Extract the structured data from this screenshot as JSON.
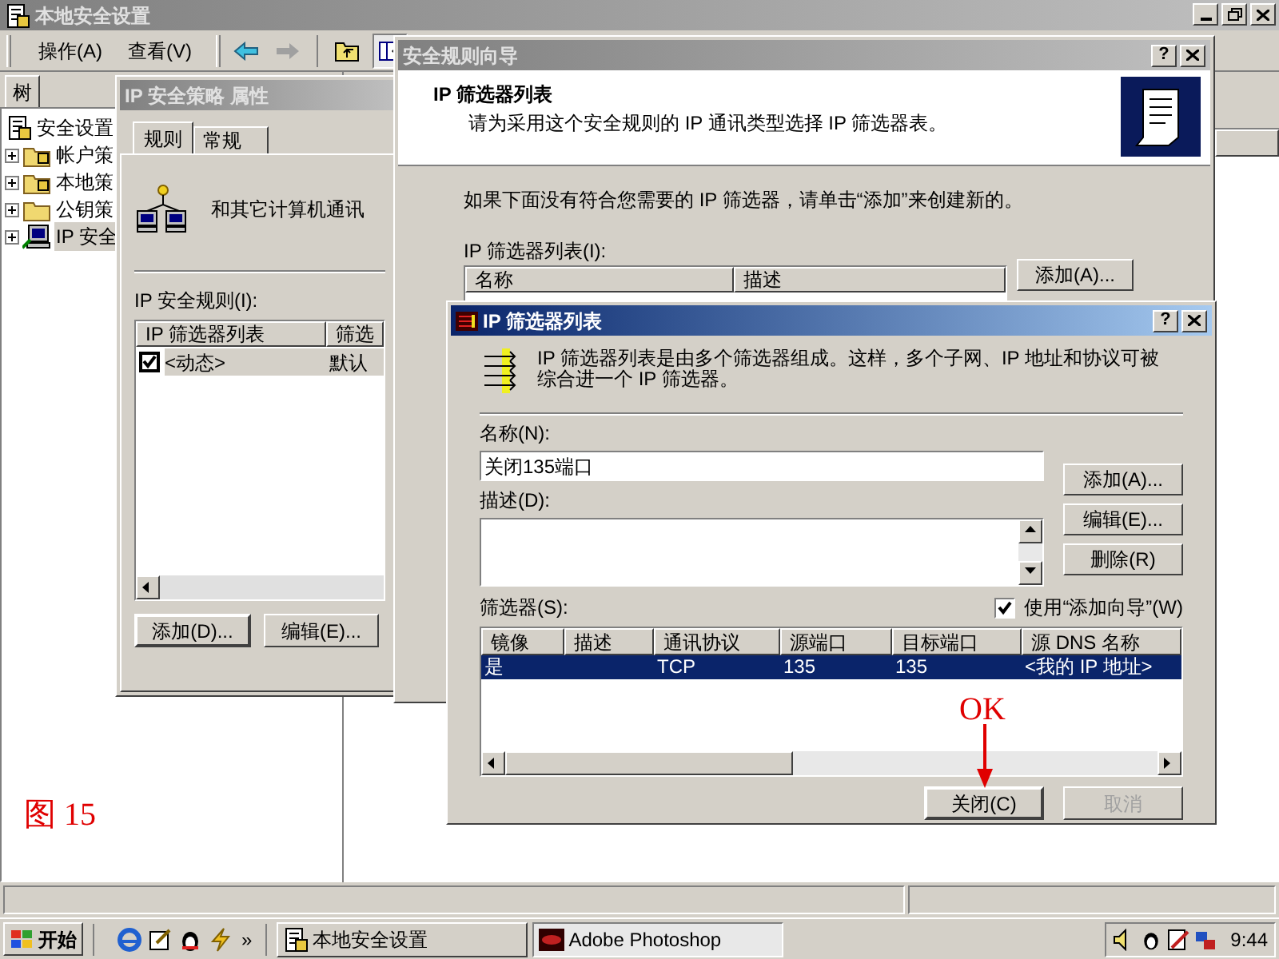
{
  "main_window": {
    "title": "本地安全设置",
    "menu": [
      "操作(A)",
      "查看(V)"
    ],
    "tree_tab": "树",
    "tree": [
      {
        "label": "安全设置",
        "kind": "policy",
        "selected": false,
        "children": [
          {
            "label": "帐户策",
            "kind": "locked-folder",
            "expanded": false,
            "selected": false
          },
          {
            "label": "本地策",
            "kind": "locked-folder",
            "expanded": false,
            "selected": false
          },
          {
            "label": "公钥策",
            "kind": "folder",
            "expanded": false,
            "selected": false
          },
          {
            "label": "IP 安全",
            "kind": "computer",
            "expanded": false,
            "selected": true
          }
        ]
      }
    ],
    "annotation": "图 15"
  },
  "policy_properties": {
    "title": "IP 安全策略 属性",
    "tabs": [
      {
        "label": "规则",
        "selected": true
      },
      {
        "label": "常规",
        "selected": false
      }
    ],
    "intro": "和其它计算机通讯",
    "rules_label": "IP 安全规则(I):",
    "columns": [
      "IP 筛选器列表",
      "筛选"
    ],
    "rows": [
      {
        "checked": true,
        "selected": true,
        "cells": [
          "<动态>",
          "默认"
        ]
      }
    ],
    "buttons": [
      "添加(D)...",
      "编辑(E)..."
    ]
  },
  "wizard": {
    "title": "安全规则向导",
    "help": "?",
    "heading": "IP 筛选器列表",
    "subheading": "请为采用这个安全规则的 IP 通讯类型选择 IP 筛选器表。",
    "instruction": "如果下面没有符合您需要的 IP 筛选器，请单击“添加”来创建新的。",
    "list_label": "IP 筛选器列表(I):",
    "columns": [
      "名称",
      "描述"
    ],
    "button": "添加(A)..."
  },
  "filter_list_dialog": {
    "title": "IP 筛选器列表",
    "help": "?",
    "description": "IP 筛选器列表是由多个筛选器组成。这样，多个子网、IP 地址和协议可被综合进一个 IP 筛选器。",
    "name_label": "名称(N):",
    "name_value": "关闭135端口",
    "desc_label": "描述(D):",
    "side_buttons": [
      "添加(A)...",
      "编辑(E)...",
      "删除(R)"
    ],
    "filters_label": "筛选器(S):",
    "use_wizard": {
      "label": "使用“添加向导”(W)",
      "checked": true
    },
    "columns": [
      "镜像",
      "描述",
      "通讯协议",
      "源端口",
      "目标端口",
      "源 DNS 名称"
    ],
    "rows": [
      {
        "selected": true,
        "mirrored": "是",
        "protocol": "TCP",
        "source_port": "135",
        "destination_port": "135",
        "source_dns": "<我的 IP 地址>"
      }
    ],
    "buttons": [
      {
        "label": "关闭(C)",
        "disabled": false
      },
      {
        "label": "取消",
        "disabled": true
      }
    ],
    "callout": "OK"
  },
  "taskbar": {
    "start": "开始",
    "more": "»",
    "tasks": [
      {
        "label": "本地安全设置",
        "selected": false,
        "kind": "console"
      },
      {
        "label": "Adobe Photoshop",
        "selected": true,
        "kind": "photoshop"
      }
    ],
    "clock": "9:44"
  }
}
